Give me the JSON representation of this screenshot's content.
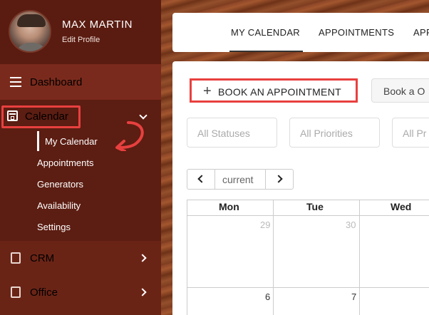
{
  "profile": {
    "name": "MAX MARTIN",
    "subtitle": "Edit Profile"
  },
  "sidebar": {
    "dashboard": "Dashboard",
    "calendar": "Calendar",
    "calendar_items": [
      "My Calendar",
      "Appointments",
      "Generators",
      "Availability",
      "Settings"
    ],
    "crm": "CRM",
    "office": "Office"
  },
  "tabs": [
    "MY CALENDAR",
    "APPOINTMENTS",
    "APP"
  ],
  "actions": {
    "book": "BOOK AN APPOINTMENT",
    "book_other": "Book a O"
  },
  "filters": [
    "All Statuses",
    "All Priorities",
    "All Pr"
  ],
  "pager": {
    "current": "current"
  },
  "calendar": {
    "days": [
      "Mon",
      "Tue",
      "Wed"
    ],
    "row1": [
      "29",
      "30"
    ],
    "row2": [
      "6",
      "7"
    ]
  },
  "colors": {
    "sidebar": "#5c1d12",
    "active_item": "#7a2a1c",
    "highlight": "#e8403f"
  }
}
